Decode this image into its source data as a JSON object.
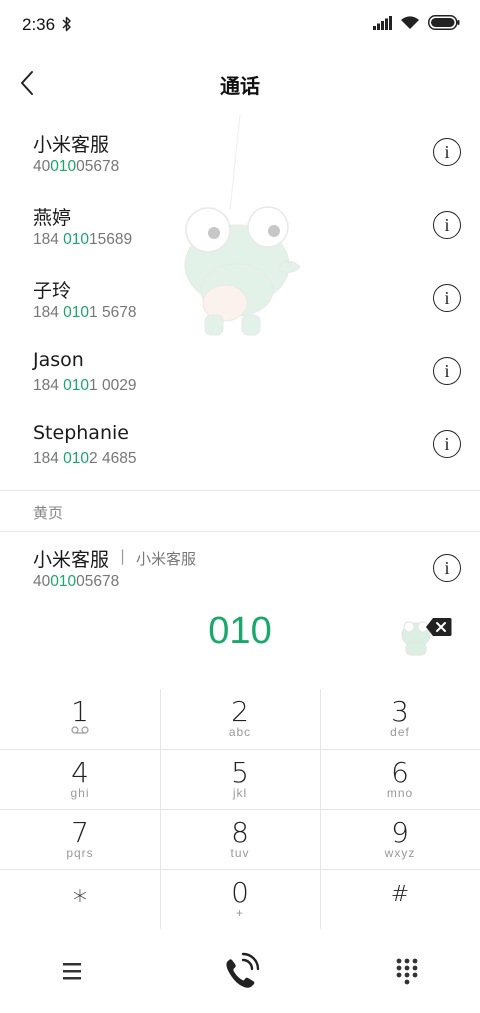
{
  "status": {
    "time": "2:36"
  },
  "header": {
    "title": "通话"
  },
  "contacts": [
    {
      "name": "小米客服",
      "number_pre": "40",
      "number_hl": "010",
      "number_post": "05678"
    },
    {
      "name": "燕婷",
      "number_pre": "184 ",
      "number_hl": "010",
      "number_post": "15689"
    },
    {
      "name": "子玲",
      "number_pre": "184 ",
      "number_hl": "010",
      "number_post": "1 5678"
    },
    {
      "name": "Jason",
      "number_pre": "184 ",
      "number_hl": "010",
      "number_post": "1 0029"
    },
    {
      "name": "Stephanie",
      "number_pre": "184 ",
      "number_hl": "010",
      "number_post": "2 4685"
    }
  ],
  "yellow_pages": {
    "section_label": "黄页",
    "name": "小米客服",
    "separator": "|",
    "tag": "小米客服",
    "number_pre": "40",
    "number_hl": "010",
    "number_post": "05678"
  },
  "dial_input": "010",
  "keypad": [
    {
      "digit": "1",
      "letters": ""
    },
    {
      "digit": "2",
      "letters": "abc"
    },
    {
      "digit": "3",
      "letters": "def"
    },
    {
      "digit": "4",
      "letters": "ghi"
    },
    {
      "digit": "5",
      "letters": "jkl"
    },
    {
      "digit": "6",
      "letters": "mno"
    },
    {
      "digit": "7",
      "letters": "pqrs"
    },
    {
      "digit": "8",
      "letters": "tuv"
    },
    {
      "digit": "9",
      "letters": "wxyz"
    },
    {
      "digit": "*",
      "letters": ""
    },
    {
      "digit": "0",
      "letters": "+"
    },
    {
      "digit": "#",
      "letters": ""
    }
  ],
  "colors": {
    "accent": "#18a86b",
    "text": "#1a1a1a",
    "secondary": "#777777",
    "divider": "#e6e6e6"
  },
  "icons": [
    "bluetooth-icon",
    "signal-icon",
    "wifi-icon",
    "battery-icon",
    "back-icon",
    "info-icon",
    "voicemail-icon",
    "backspace-icon",
    "menu-icon",
    "call-icon",
    "dialpad-icon"
  ]
}
